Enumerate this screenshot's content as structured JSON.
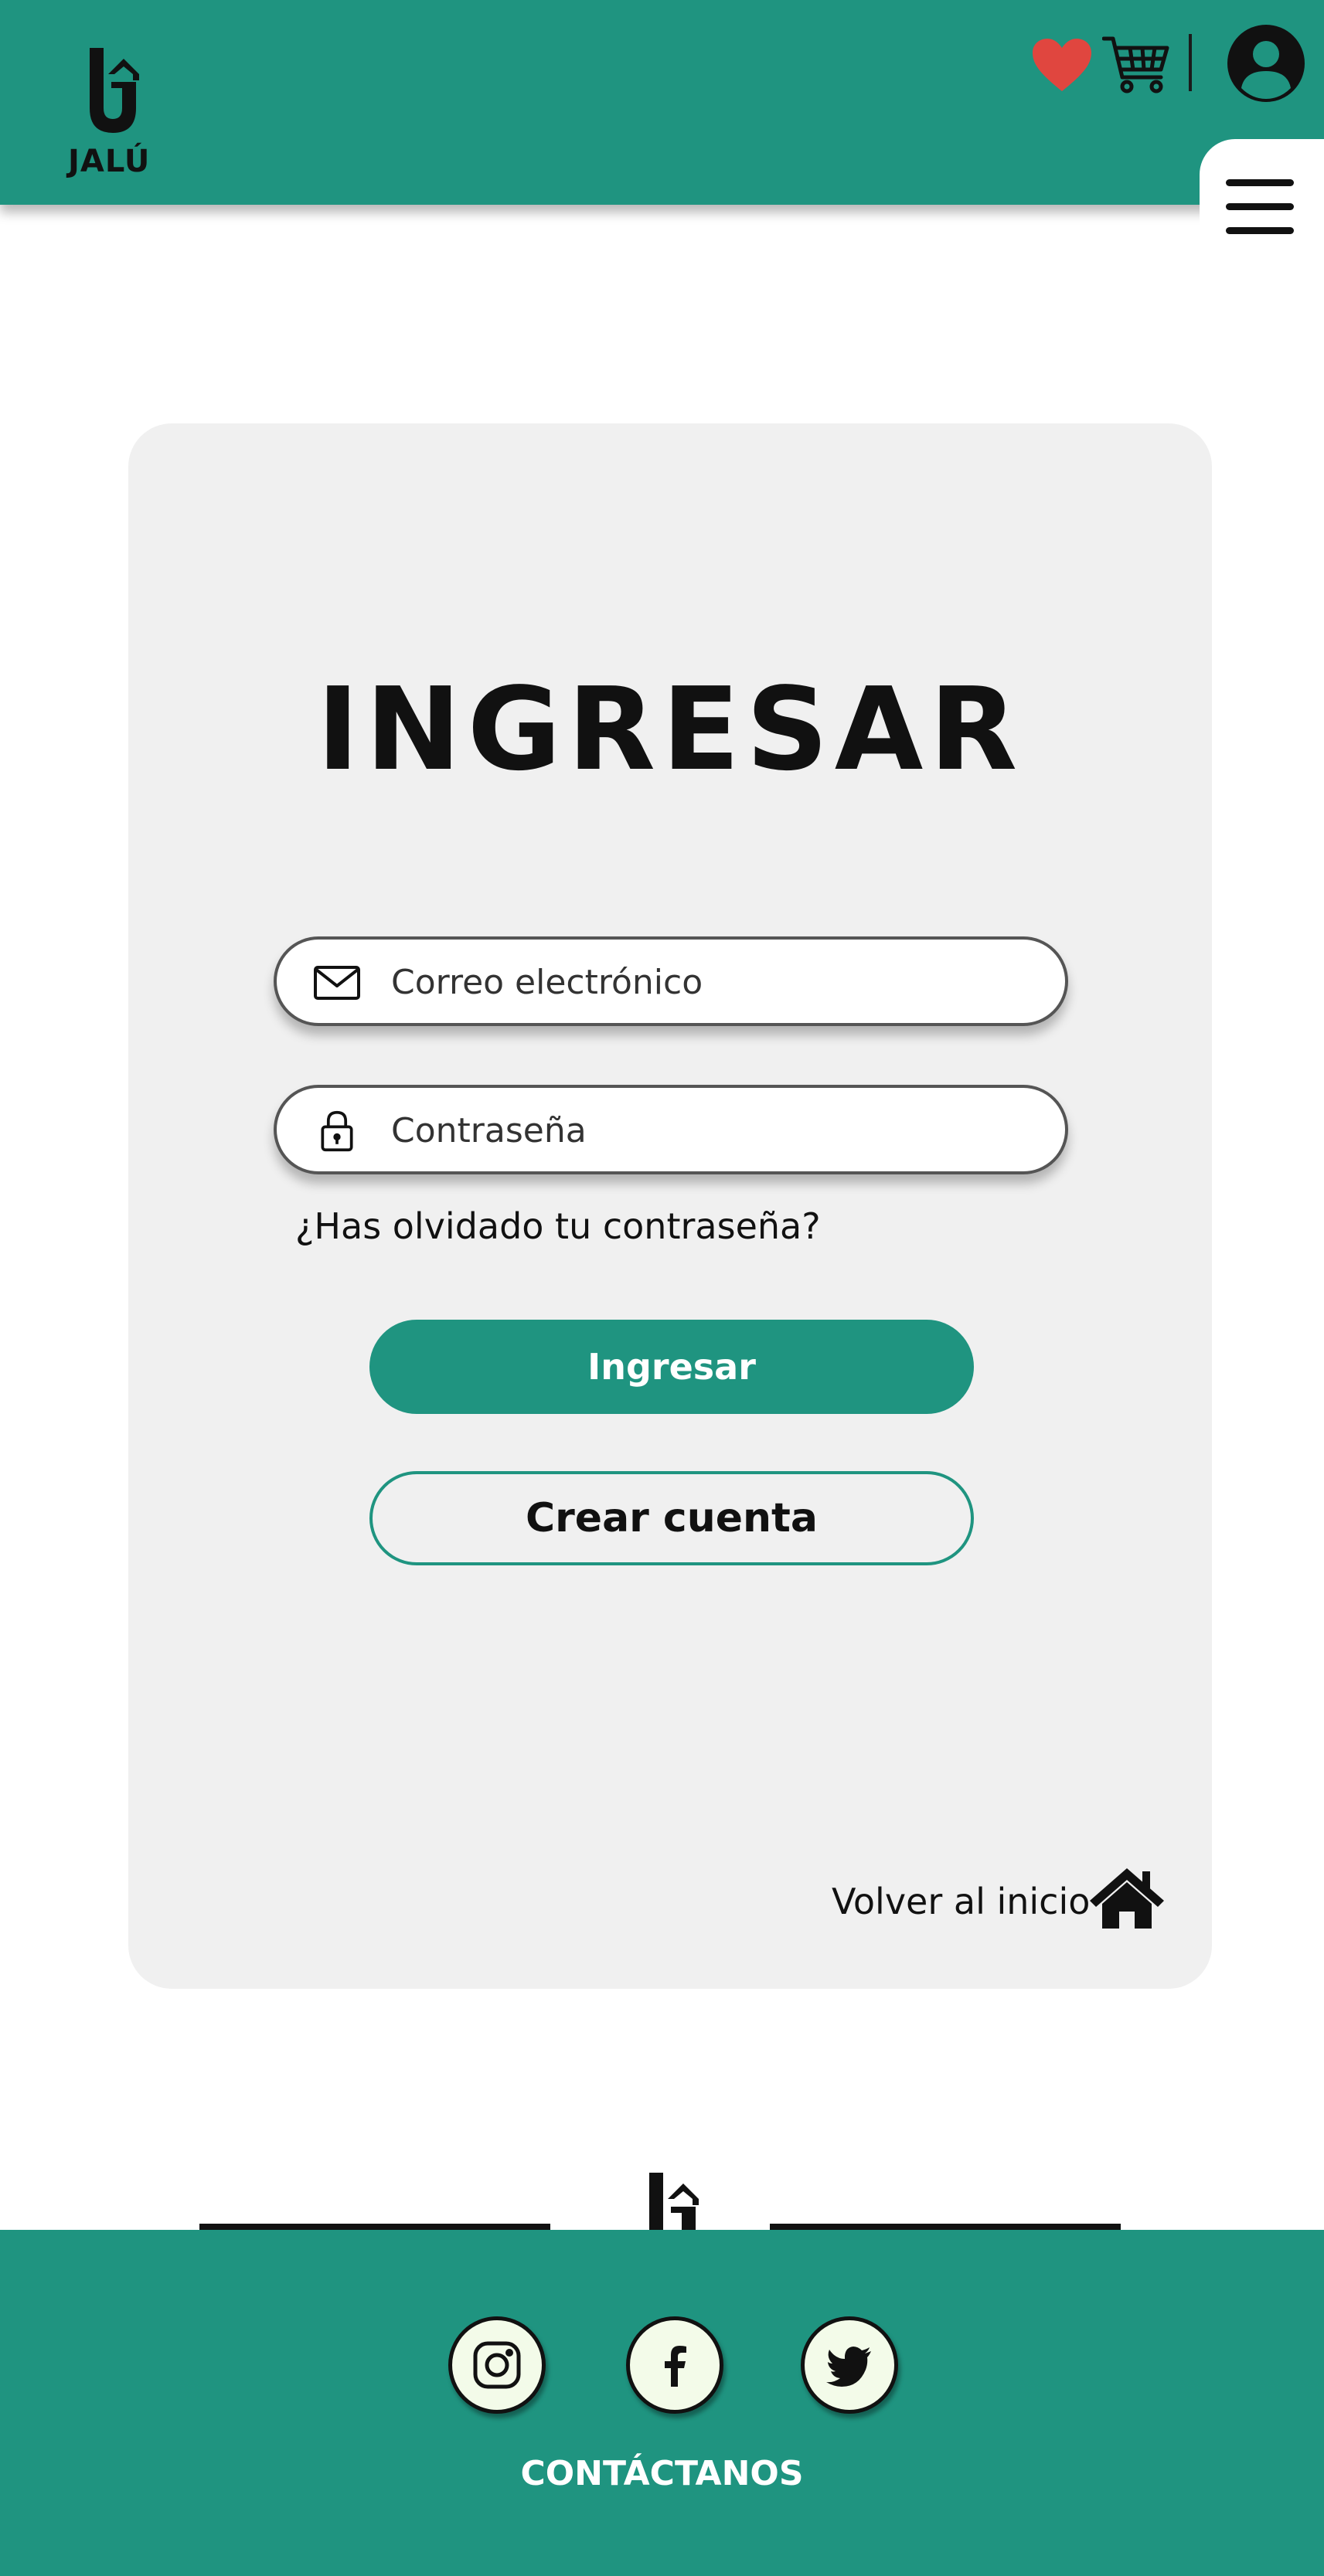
{
  "header": {
    "brand": "JALÚ",
    "icons": [
      "heart-icon",
      "cart-icon",
      "user-icon",
      "menu-icon"
    ]
  },
  "login": {
    "title": "INGRESAR",
    "email_placeholder": "Correo electrónico",
    "password_placeholder": "Contraseña",
    "forgot_link": "¿Has olvidado tu contraseña?",
    "submit_label": "Ingresar",
    "create_account_label": "Crear cuenta",
    "back_home_label": "Volver al inicio"
  },
  "footer": {
    "social": [
      "instagram-icon",
      "facebook-icon",
      "twitter-icon"
    ],
    "contact_label": "CONTÁCTANOS"
  },
  "colors": {
    "brand_teal": "#1f9480",
    "card_bg": "#f0f0f0",
    "heart_red": "#e0463f",
    "social_bg": "#f3fbe9"
  }
}
